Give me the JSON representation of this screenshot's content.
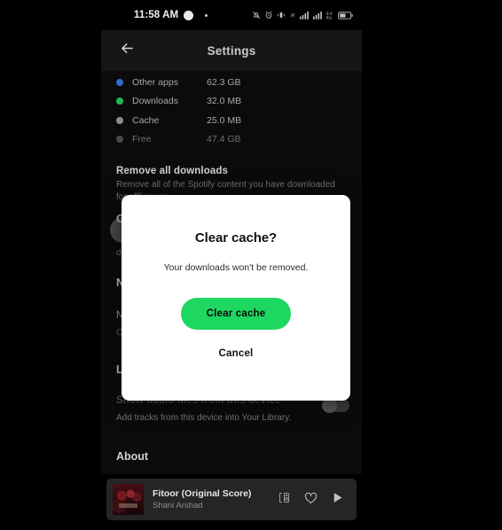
{
  "status_bar": {
    "time": "11:58 AM",
    "icons_left": [
      "circle-badge-icon",
      "small-dot-icon"
    ],
    "icons_right": [
      "notification-off-icon",
      "alarm-icon",
      "vibrate-icon",
      "data-transfer-icon",
      "signal-bars-1-icon",
      "signal-bars-2-icon",
      "network-speed-icon",
      "battery-icon"
    ],
    "network_speed": "9.4",
    "network_speed_unit": "K/s",
    "signal_label": "4G"
  },
  "app_bar": {
    "title": "Settings",
    "back_icon": "arrow-left-icon"
  },
  "storage_legend": [
    {
      "label": "Other apps",
      "value": "62.3 GB",
      "color": "#2e6fd1"
    },
    {
      "label": "Downloads",
      "value": "32.0 MB",
      "color": "#1db954"
    },
    {
      "label": "Cache",
      "value": "25.0 MB",
      "color": "#8d8d8d"
    },
    {
      "label": "Free",
      "value": "47.4 GB",
      "color": "#4a4a4a"
    }
  ],
  "sections": {
    "remove_downloads": {
      "title": "Remove all downloads",
      "subtitle": "Remove all of the Spotify content you have downloaded for offline use."
    },
    "clear_cache_button_label": "Clear cache",
    "occluded_left_letters": [
      "C",
      "N",
      "N",
      "O",
      "L"
    ],
    "local_files": {
      "title": "Show audio files from this device",
      "subtitle": "Add tracks from this device into Your Library.",
      "toggle_state": "off"
    },
    "about_heading": "About"
  },
  "dialog": {
    "title": "Clear cache?",
    "message": "Your downloads won't be removed.",
    "confirm_label": "Clear cache",
    "cancel_label": "Cancel",
    "accent_color": "#1ed760",
    "background_color": "#ffffff"
  },
  "now_playing": {
    "track_title": "Fitoor (Original Score)",
    "artist": "Shani Arshad",
    "controls": [
      "connect-device-icon",
      "heart-icon",
      "play-icon"
    ]
  }
}
